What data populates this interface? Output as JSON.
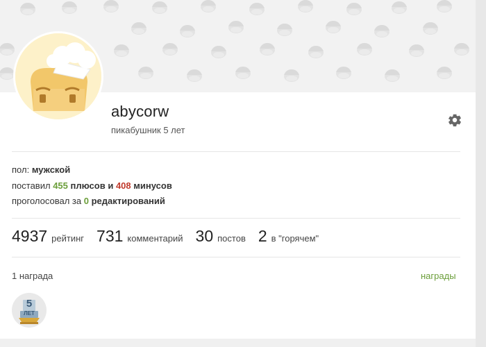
{
  "profile": {
    "username": "abycorw",
    "subtitle": "пикабушник 5 лет"
  },
  "info": {
    "gender_label": "пол:",
    "gender_value": "мужской",
    "voted_prefix": "поставил",
    "plus_count": "455",
    "plus_label": "плюсов и",
    "minus_count": "408",
    "minus_label": "минусов",
    "edits_prefix": "проголосовал за",
    "edits_count": "0",
    "edits_label": "редактирований"
  },
  "stats": [
    {
      "value": "4937",
      "label": "рейтинг"
    },
    {
      "value": "731",
      "label": "комментарий"
    },
    {
      "value": "30",
      "label": "постов"
    },
    {
      "value": "2",
      "label": "в \"горячем\""
    }
  ],
  "awards": {
    "count_text": "1 награда",
    "link_text": "награды",
    "badge_top": "5",
    "badge_bottom": "ЛЕТ"
  },
  "colors": {
    "accent_green": "#6b9e3a",
    "minus_red": "#c0392b"
  },
  "icons": {
    "settings": "gear-icon",
    "avatar": "chef-toast-avatar",
    "badge": "five-years-trophy-icon"
  }
}
